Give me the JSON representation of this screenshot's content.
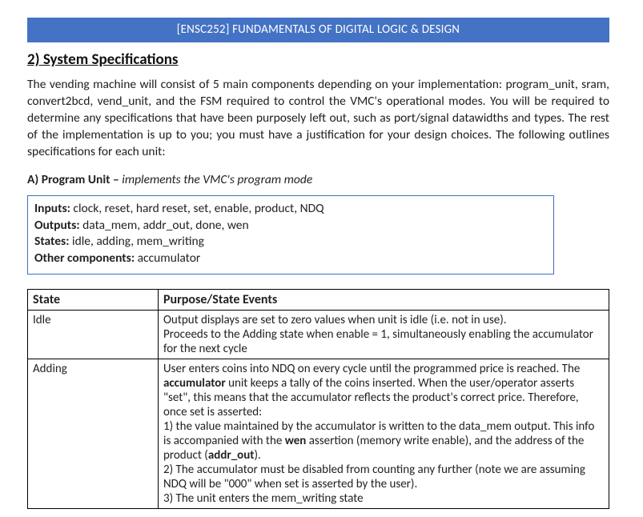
{
  "banner": "[ENSC252] FUNDAMENTALS OF DIGITAL LOGIC & DESIGN",
  "section_heading": "2) System Specifications",
  "intro_paragraph": "The vending machine will consist of 5 main components depending on your implementation: program_unit, sram, convert2bcd, vend_unit, and the FSM required to control the VMC's operational modes. You will be required to determine any specifications that have been purposely left out, such as port/signal datawidths and types. The rest of the implementation is up to you; you must have a justification for your design choices. The following outlines specifications for each unit:",
  "program_unit": {
    "label": "A) Program Unit – ",
    "desc": "implements the VMC's program mode",
    "io": {
      "inputs_label": "Inputs:",
      "inputs": " clock, reset, hard reset, set, enable, product, NDQ",
      "outputs_label": "Outputs:",
      "outputs": " data_mem, addr_out, done, wen",
      "states_label": "States:",
      "states": " idle, adding, mem_writing",
      "other_label": "Other components:",
      "other": " accumulator"
    }
  },
  "table": {
    "head_state": "State",
    "head_purpose": "Purpose/State Events",
    "rows": {
      "idle": {
        "state": "Idle",
        "l1": "Output displays are set to zero values when unit is idle (i.e. not in use).",
        "l2": "Proceeds to the Adding state when enable = 1, simultaneously enabling the accumulator for the next cycle"
      },
      "adding": {
        "state": "Adding",
        "p1a": "User enters coins into NDQ on every cycle until the programmed price is reached. The ",
        "p1b": "accumulator",
        "p1c": " unit keeps a tally of the coins inserted. When the user/operator asserts \"set\", this means that the accumulator reflects the product's correct price. Therefore, once set is asserted:",
        "p2a": "1) the value maintained by the accumulator is written to the data_mem output. This info is accompanied with the ",
        "p2b": "wen",
        "p2c": " assertion (memory write enable), and the address of the product (",
        "p2d": "addr_out",
        "p2e": ").",
        "p3": "2) The accumulator must be disabled from counting any further (note we are assuming NDQ will be \"000\" when set is asserted by the user).",
        "p4": "3) The unit enters the mem_writing state"
      }
    }
  }
}
